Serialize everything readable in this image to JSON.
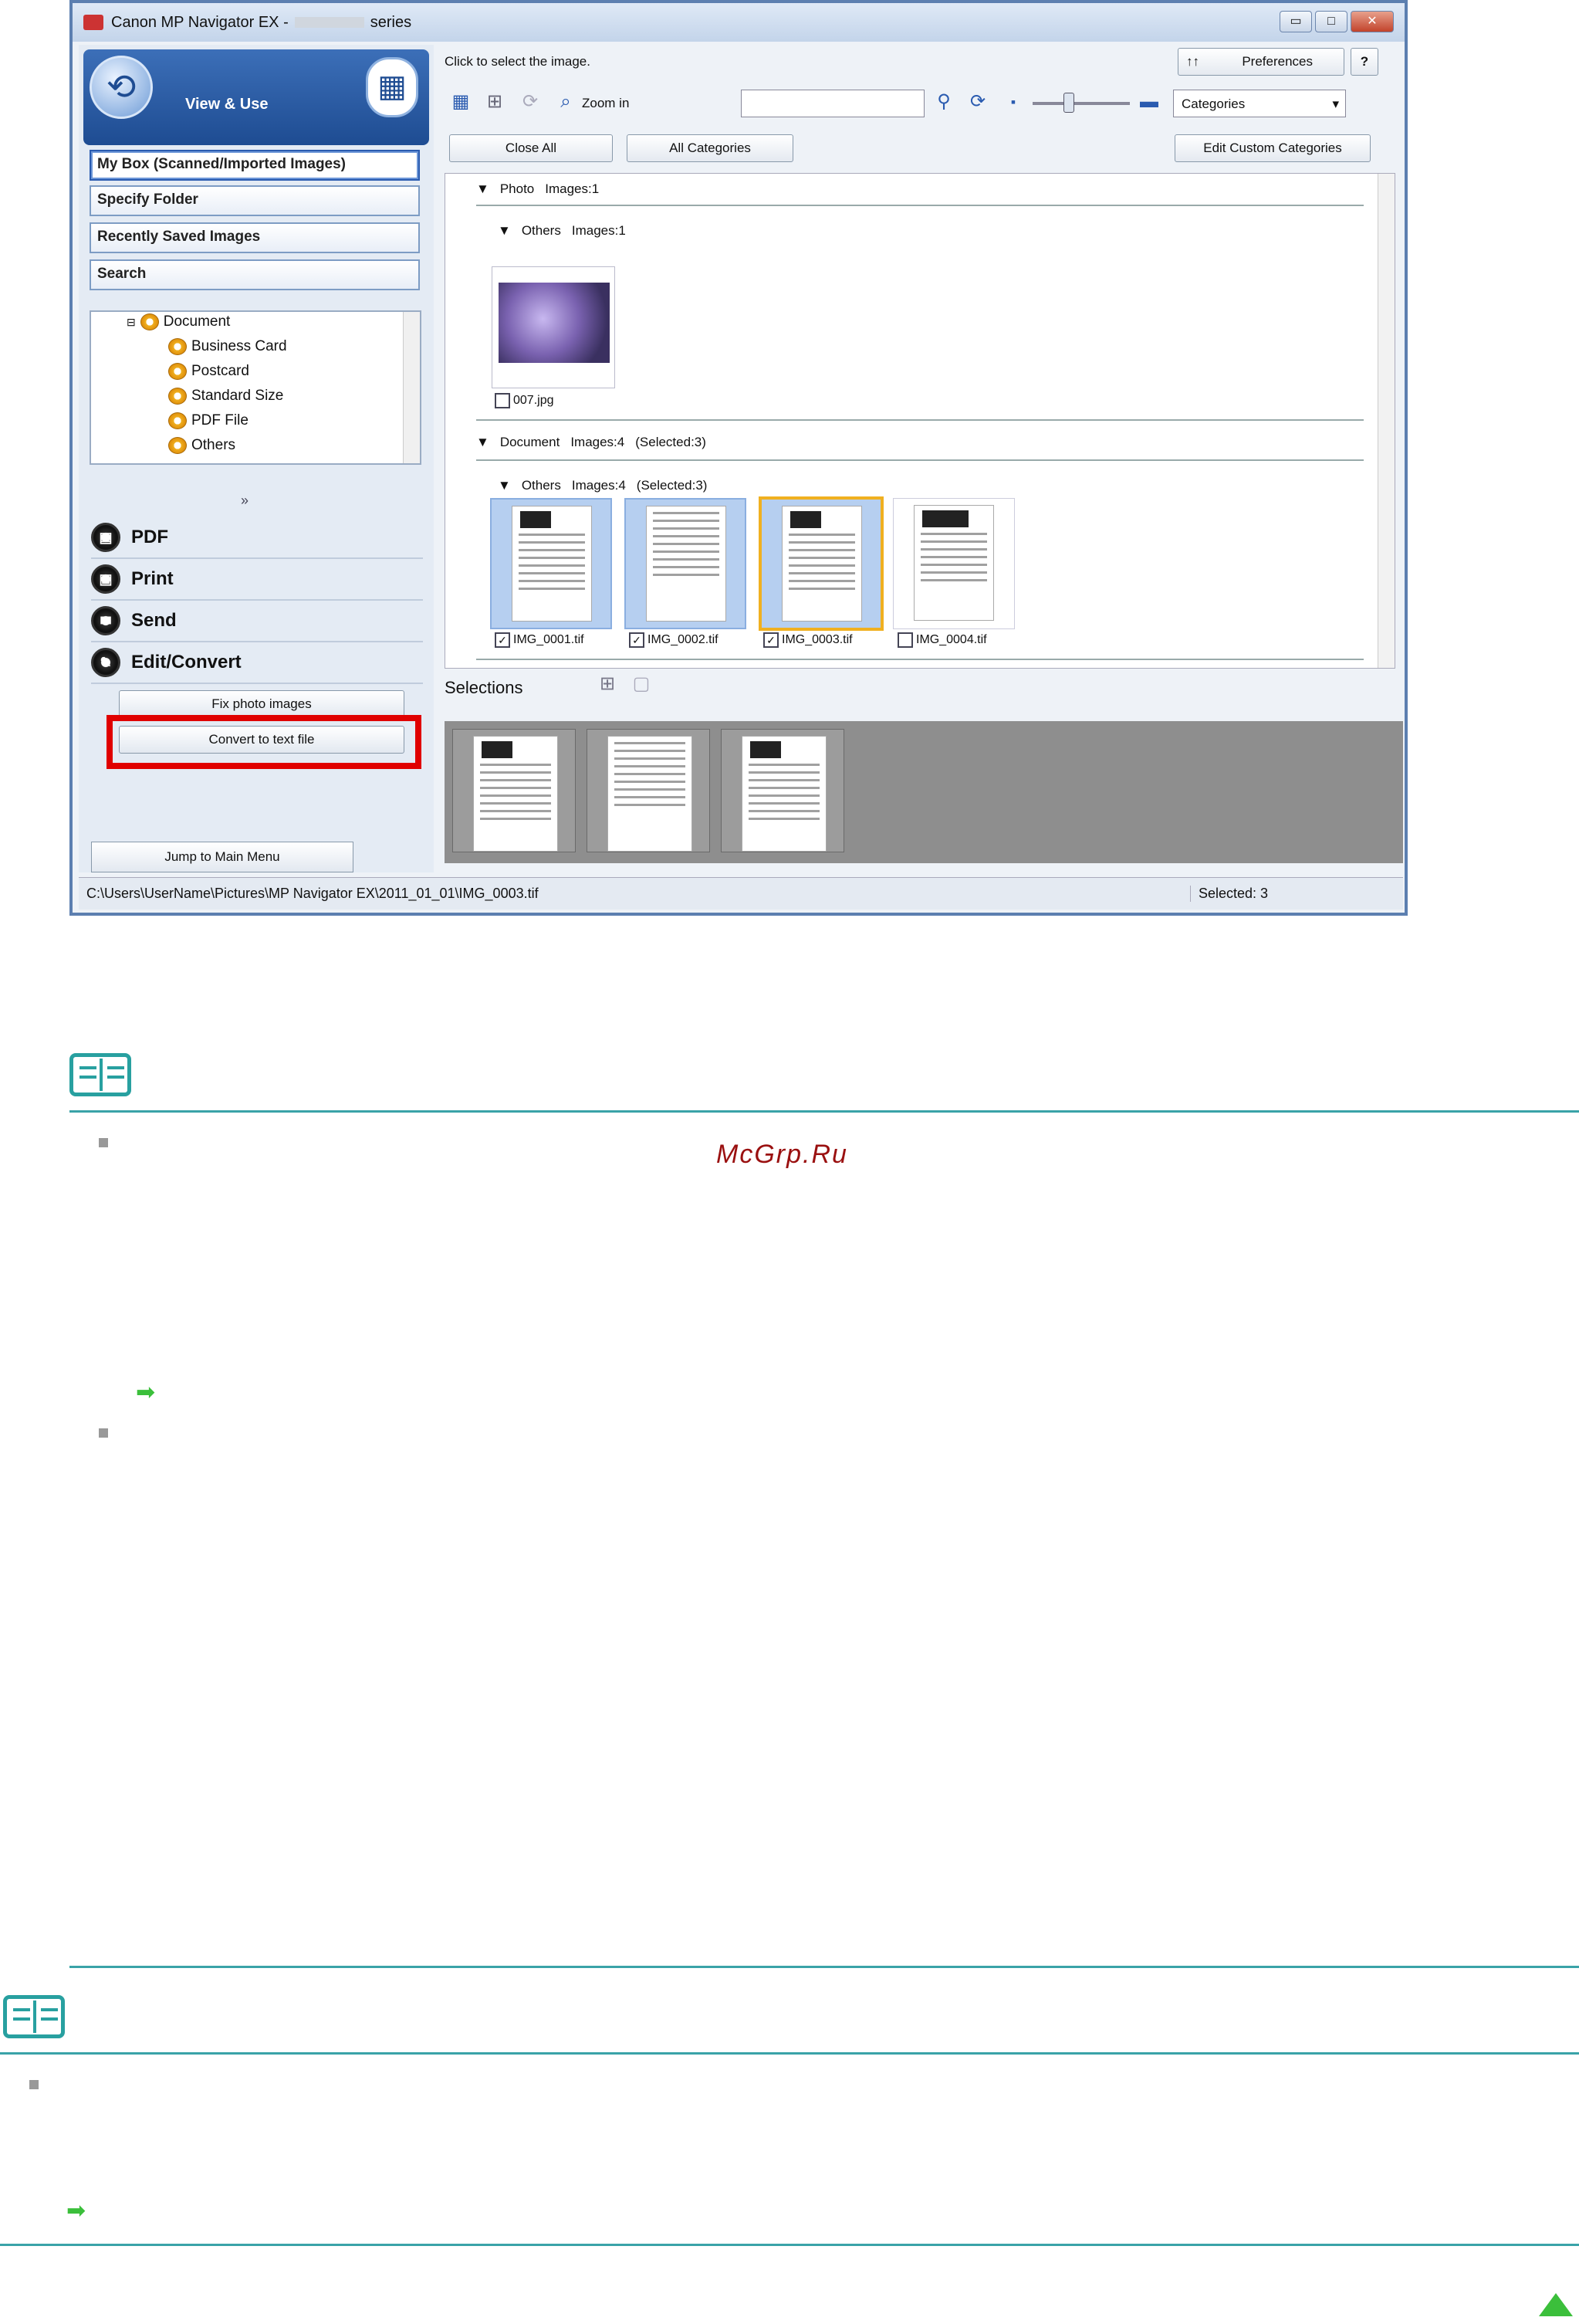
{
  "window": {
    "title_prefix": "Canon MP Navigator EX -",
    "title_suffix": "series",
    "minimize": "▭",
    "maximize": "□",
    "close": "✕"
  },
  "mode": {
    "title": "View & Use"
  },
  "nav": {
    "items": [
      {
        "label": "My Box (Scanned/Imported Images)"
      },
      {
        "label": "Specify Folder"
      },
      {
        "label": "Recently Saved Images"
      },
      {
        "label": "Search"
      }
    ]
  },
  "tree": {
    "items": [
      {
        "label": "Document"
      },
      {
        "label": "Business Card"
      },
      {
        "label": "Postcard"
      },
      {
        "label": "Standard Size"
      },
      {
        "label": "PDF File"
      },
      {
        "label": "Others"
      }
    ]
  },
  "actions": {
    "expand_glyph": "»",
    "items": [
      {
        "label": "PDF"
      },
      {
        "label": "Print"
      },
      {
        "label": "Send"
      },
      {
        "label": "Edit/Convert"
      }
    ],
    "fix_photo": "Fix photo images",
    "convert_text": "Convert to text file",
    "jump_main": "Jump to Main Menu"
  },
  "toolbar": {
    "hint": "Click to select the image.",
    "preferences": "Preferences",
    "help": "?",
    "zoom_in": "Zoom in",
    "search_value": "",
    "view_select": "Categories",
    "close_all": "Close All",
    "all_categories": "All Categories",
    "edit_custom": "Edit Custom Categories"
  },
  "groups": {
    "photo": {
      "name": "Photo",
      "count": "Images:1"
    },
    "photo_others": {
      "name": "Others",
      "count": "Images:1"
    },
    "photo_file": "007.jpg",
    "document": {
      "name": "Document",
      "count": "Images:4",
      "selected": "(Selected:3)"
    },
    "doc_others": {
      "name": "Others",
      "count": "Images:4",
      "selected": "(Selected:3)"
    },
    "doc_files": [
      {
        "name": "IMG_0001.tif",
        "checked": "✓"
      },
      {
        "name": "IMG_0002.tif",
        "checked": "✓"
      },
      {
        "name": "IMG_0003.tif",
        "checked": "✓"
      },
      {
        "name": "IMG_0004.tif",
        "checked": ""
      }
    ]
  },
  "selections": {
    "label": "Selections"
  },
  "status": {
    "path": "C:\\Users\\UserName\\Pictures\\MP Navigator EX\\2011_01_01\\IMG_0003.tif",
    "selected": "Selected: 3"
  },
  "page": {
    "watermark": "McGrp.Ru"
  },
  "colors": {
    "accent": "#1e4c92",
    "note_teal": "#3aa3a8",
    "link_green": "#3bbf3b",
    "highlight": "#e00000"
  }
}
